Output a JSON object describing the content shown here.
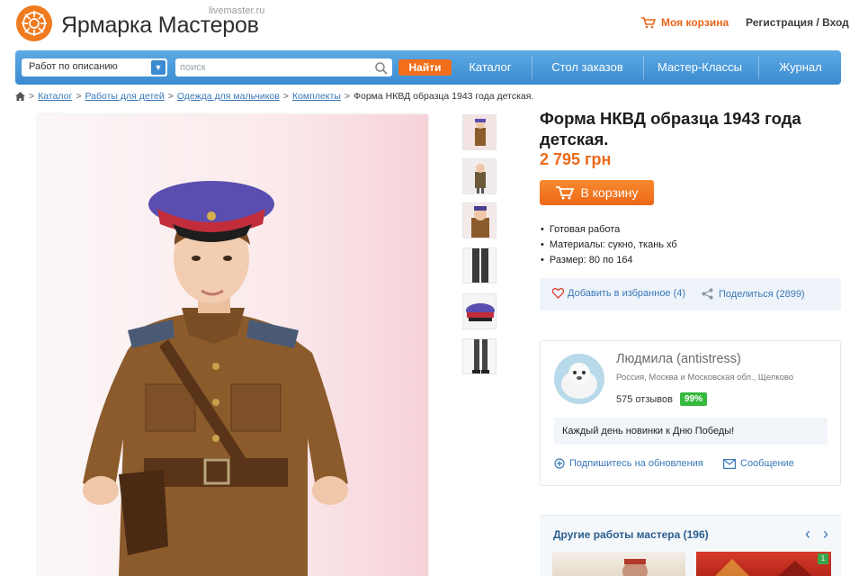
{
  "header": {
    "logo_text": "Ярмарка Мастеров",
    "logo_domain": "livemaster.ru",
    "cart_label": "Моя корзина",
    "auth_label": "Регистрация / Вход"
  },
  "navbar": {
    "search_scope": "Работ по описанию",
    "search_placeholder": "поиск",
    "find_label": "Найти",
    "items": [
      "Каталог",
      "Стол заказов",
      "Мастер-Классы",
      "Журнал"
    ]
  },
  "breadcrumb": {
    "links": [
      "Каталог",
      "Работы для детей",
      "Одежда для мальчиков",
      "Комплекты"
    ],
    "current": "Форма НКВД образца 1943 года детская."
  },
  "product": {
    "title": "Форма НКВД образца 1943 года детская.",
    "price": "2 795 грн",
    "cart_button": "В корзину",
    "properties": [
      "Готовая работа",
      "Материалы: сукно, ткань хб",
      "Размер: 80 по 164"
    ],
    "favorite_label": "Добавить в избранное (4)",
    "share_label": "Поделиться (2899)"
  },
  "seller": {
    "name": "Людмила (antistress)",
    "location": "Россия, Москва и Московская обл., Щелково",
    "reviews": "575 отзывов",
    "rating": "99%",
    "note": "Каждый день новинки к Дню Победы!",
    "subscribe_label": "Подпишитесь на обновления",
    "message_label": "Сообщение"
  },
  "other_works": {
    "title": "Другие работы мастера (196)",
    "badge": "1"
  },
  "colors": {
    "accent_orange": "#f36e1a",
    "nav_blue": "#3a8bd0",
    "link_blue": "#3a77b8",
    "rating_green": "#37b83f"
  }
}
